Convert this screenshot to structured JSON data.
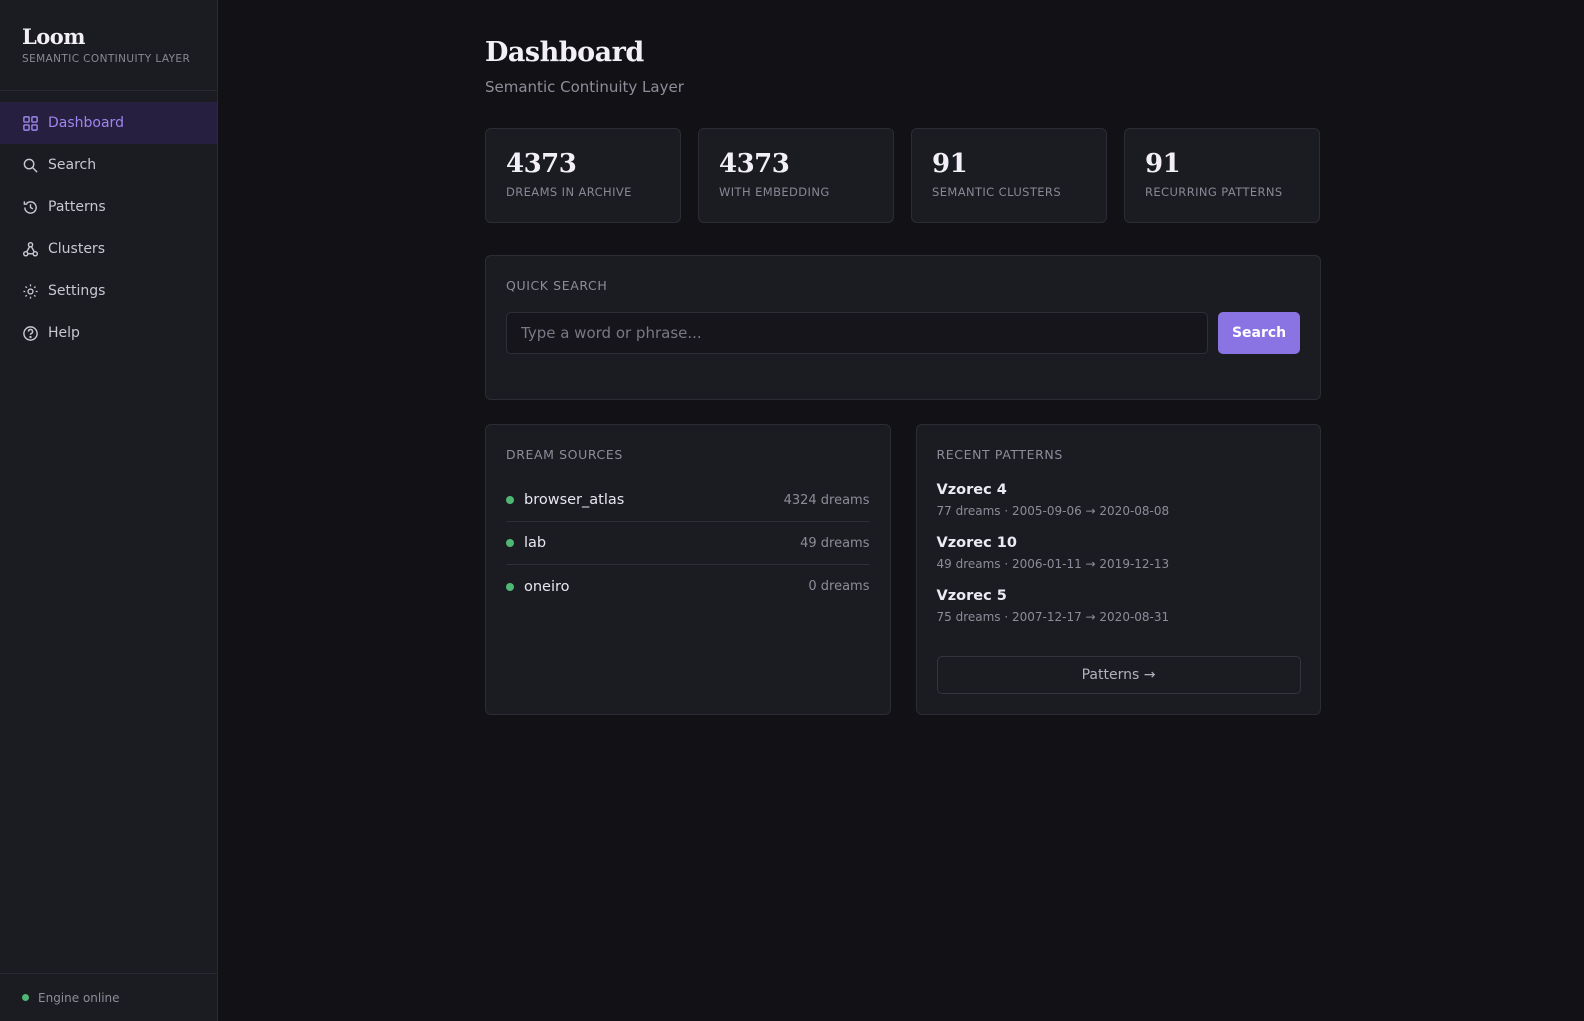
{
  "brand": {
    "title": "Loom",
    "subtitle": "SEMANTIC CONTINUITY LAYER"
  },
  "nav": [
    {
      "label": "Dashboard",
      "icon": "grid-icon",
      "active": true
    },
    {
      "label": "Search",
      "icon": "search-icon"
    },
    {
      "label": "Patterns",
      "icon": "history-icon"
    },
    {
      "label": "Clusters",
      "icon": "clusters-icon"
    },
    {
      "label": "Settings",
      "icon": "gear-icon"
    },
    {
      "label": "Help",
      "icon": "help-icon"
    }
  ],
  "footer": {
    "status": "Engine online",
    "status_color": "#4fb774"
  },
  "page": {
    "title": "Dashboard",
    "subtitle": "Semantic Continuity Layer"
  },
  "stats": [
    {
      "value": "4373",
      "label": "DREAMS IN ARCHIVE"
    },
    {
      "value": "4373",
      "label": "WITH EMBEDDING"
    },
    {
      "value": "91",
      "label": "SEMANTIC CLUSTERS"
    },
    {
      "value": "91",
      "label": "RECURRING PATTERNS"
    }
  ],
  "quick_search": {
    "title": "QUICK SEARCH",
    "placeholder": "Type a word or phrase...",
    "button": "Search"
  },
  "sources": {
    "title": "DREAM SOURCES",
    "items": [
      {
        "name": "browser_atlas",
        "count": "4324 dreams"
      },
      {
        "name": "lab",
        "count": "49 dreams"
      },
      {
        "name": "oneiro",
        "count": "0 dreams"
      }
    ]
  },
  "patterns": {
    "title": "RECENT PATTERNS",
    "items": [
      {
        "name": "Vzorec 4",
        "meta": "77 dreams · 2005-09-06 → 2020-08-08"
      },
      {
        "name": "Vzorec 10",
        "meta": "49 dreams · 2006-01-11 → 2019-12-13"
      },
      {
        "name": "Vzorec 5",
        "meta": "75 dreams · 2007-12-17 → 2020-08-31"
      }
    ],
    "button": "Patterns →"
  },
  "colors": {
    "accent": "#8a74e4",
    "active_nav_bg": "#271f3f",
    "online": "#4fb774"
  }
}
